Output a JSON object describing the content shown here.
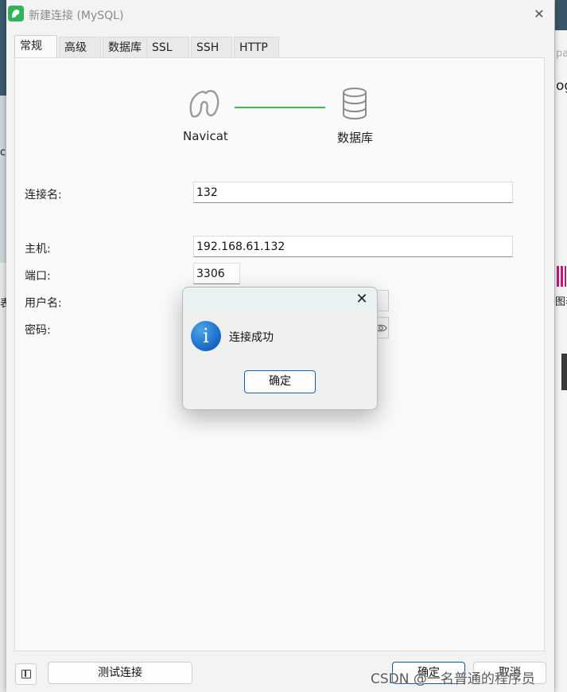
{
  "window": {
    "title": "新建连接 (MySQL)",
    "close_glyph": "✕"
  },
  "tabs": [
    {
      "label": "常规",
      "active": true
    },
    {
      "label": "高级",
      "active": false
    },
    {
      "label": "数据库",
      "active": false
    },
    {
      "label": "SSL",
      "active": false
    },
    {
      "label": "SSH",
      "active": false
    },
    {
      "label": "HTTP",
      "active": false
    }
  ],
  "diagram": {
    "left_label": "Navicat",
    "right_label": "数据库",
    "link_color": "#3cbf4a"
  },
  "form": {
    "connection_name_label": "连接名:",
    "connection_name_value": "132",
    "host_label": "主机:",
    "host_value": "192.168.61.132",
    "port_label": "端口:",
    "port_value": "3306",
    "username_label": "用户名:",
    "password_label": "密码:"
  },
  "bottom": {
    "test_button": "测试连接",
    "ok_button": "确定",
    "cancel_button": "取消"
  },
  "dialog": {
    "close_glyph": "✕",
    "icon_glyph": "i",
    "message": "连接成功",
    "ok_button": "确定"
  },
  "watermark": "CSDN @一名普通的程序员",
  "background_fragments": {
    "right_top_1": "pa",
    "right_top_2": "og",
    "right_mid": "图表",
    "left_1": "c",
    "left_2": "表"
  },
  "colors": {
    "accent_blue": "#1464b4",
    "navicat_green": "#2fb45a"
  }
}
